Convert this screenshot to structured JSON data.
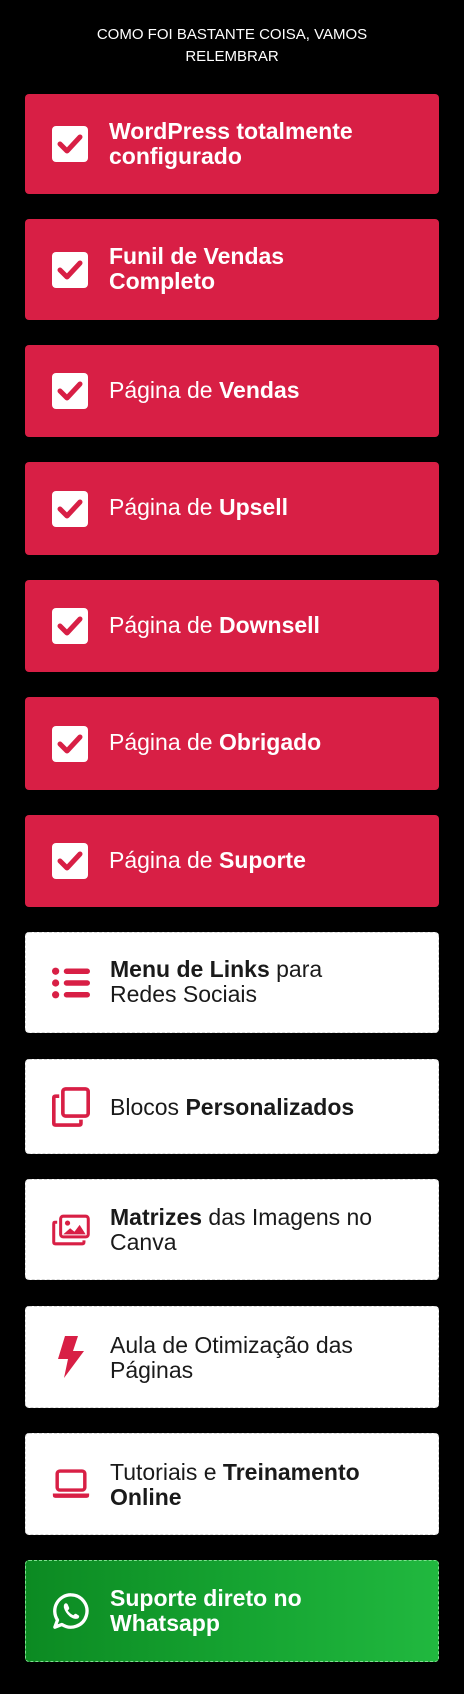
{
  "header": {
    "line1": "COMO FOI BASTANTE COISA, VAMOS",
    "line2": "RELEMBRAR"
  },
  "colors": {
    "red": "#d81f45",
    "white": "#ffffff",
    "green": "#16a532",
    "background": "#000000"
  },
  "items": [
    {
      "icon": "check-square-icon",
      "line1_bold": "WordPress totalmente",
      "line2_bold": "configurado"
    },
    {
      "icon": "check-square-icon",
      "line1_bold": "Funil de Vendas",
      "line2_bold": "Completo"
    },
    {
      "icon": "check-square-icon",
      "prefix": "Página de ",
      "bold": "Vendas"
    },
    {
      "icon": "check-square-icon",
      "prefix": "Página de ",
      "bold": "Upsell"
    },
    {
      "icon": "check-square-icon",
      "prefix": "Página de ",
      "bold": "Downsell"
    },
    {
      "icon": "check-square-icon",
      "prefix": "Página de ",
      "bold": "Obrigado"
    },
    {
      "icon": "check-square-icon",
      "prefix": "Página de ",
      "bold": "Suporte"
    },
    {
      "icon": "list-icon",
      "bold": "Menu de Links",
      "suffix": " para",
      "line2": "Redes Sociais"
    },
    {
      "icon": "copy-blocks-icon",
      "prefix": "Blocos ",
      "bold": "Personalizados"
    },
    {
      "icon": "images-icon",
      "bold": "Matrizes",
      "suffix": " das Imagens no",
      "line2": "Canva"
    },
    {
      "icon": "bolt-icon",
      "line1": "Aula de Otimização das",
      "line2": "Páginas"
    },
    {
      "icon": "laptop-icon",
      "prefix": "Tutoriais e ",
      "bold": "Treinamento",
      "line2_bold": "Online"
    },
    {
      "icon": "whatsapp-icon",
      "line1_bold": "Suporte direto no",
      "line2_bold": "Whatsapp"
    }
  ]
}
